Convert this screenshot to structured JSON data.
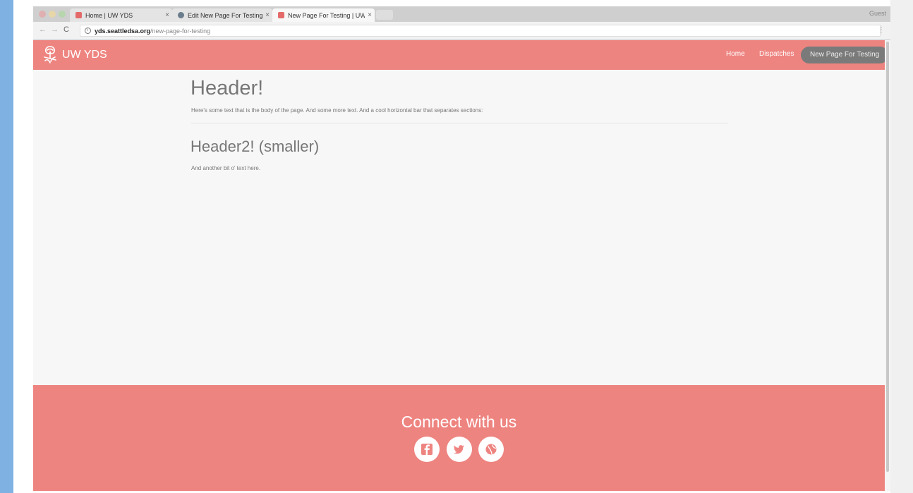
{
  "browser": {
    "tabs": [
      {
        "title": "Home | UW YDS",
        "close": "×"
      },
      {
        "title": "Edit New Page For Testing | UW",
        "close": "×"
      },
      {
        "title": "New Page For Testing | UW YDS",
        "close": "×"
      }
    ],
    "profile": "Guest",
    "nav": {
      "back": "←",
      "forward": "→",
      "reload": "C"
    },
    "address": {
      "info": "i",
      "host": "yds.seattledsa.org",
      "path": "/new-page-for-testing"
    },
    "menu": "⋮"
  },
  "site": {
    "brand": "UW YDS",
    "nav": [
      "Home",
      "Dispatches",
      "New Page For Testing"
    ]
  },
  "page": {
    "heading": "Header!",
    "body": "Here's some text that is the body of the page. And some more text. And a cool horizontal bar that separates sections:",
    "heading2": "Header2! (smaller)",
    "body2": "And another bit o' text here."
  },
  "footer": {
    "title": "Connect with us",
    "icons": [
      "facebook-icon",
      "twitter-icon",
      "globe-icon"
    ]
  },
  "colors": {
    "brand": "#ee8480",
    "active_nav": "#7a7a7a",
    "content_bg": "#f7f7f7"
  }
}
